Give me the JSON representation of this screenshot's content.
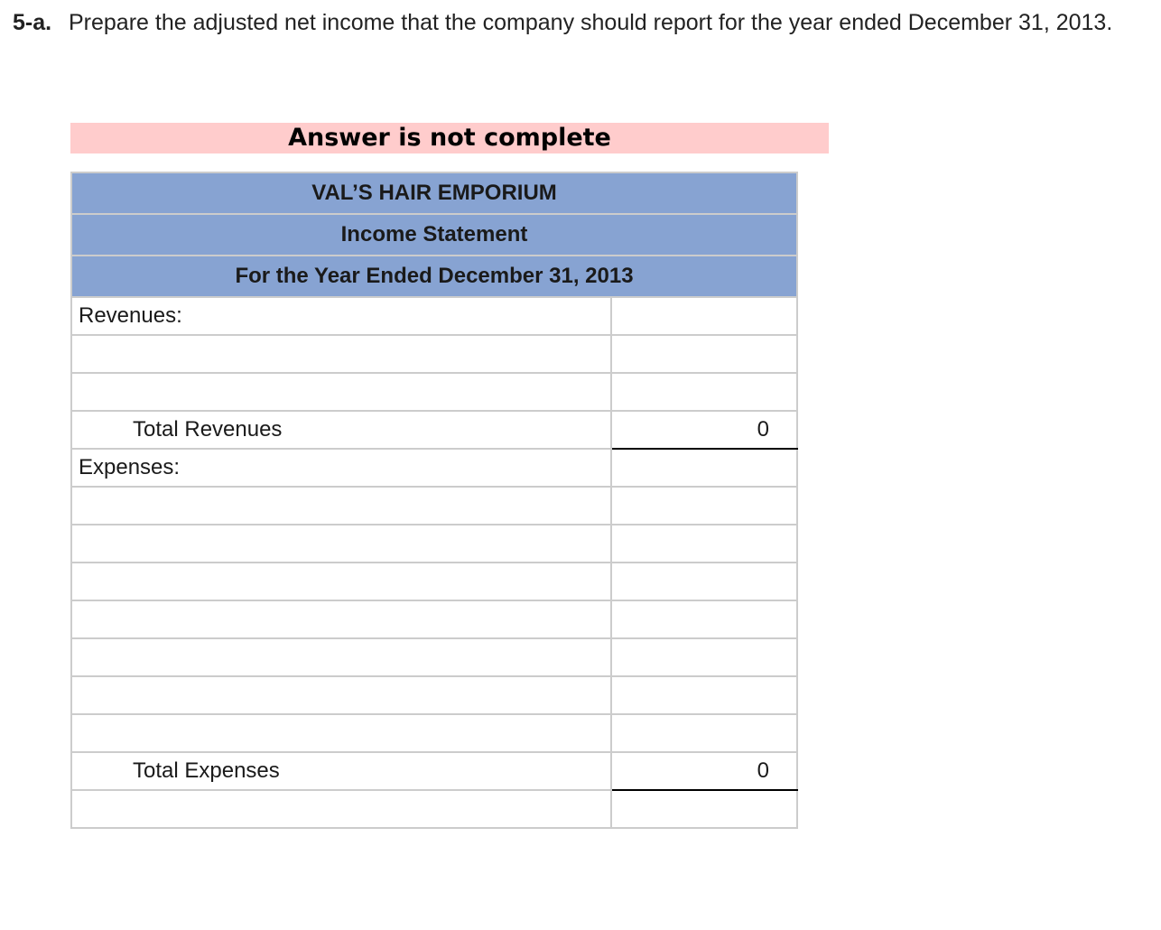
{
  "question": {
    "number": "5-a.",
    "text": "Prepare the adjusted net income that the company should report for the year ended December 31, 2013."
  },
  "banner": {
    "text": "Answer is not complete",
    "color": "#ffcccc"
  },
  "statement": {
    "company": "VAL’S HAIR EMPORIUM",
    "title": "Income Statement",
    "period": "For the Year Ended December 31, 2013",
    "header_color": "#87a3d2",
    "revenues_label": "Revenues:",
    "total_revenues_label": "Total Revenues",
    "total_revenues_value": "0",
    "expenses_label": "Expenses:",
    "total_expenses_label": "Total Expenses",
    "total_expenses_value": "0"
  }
}
